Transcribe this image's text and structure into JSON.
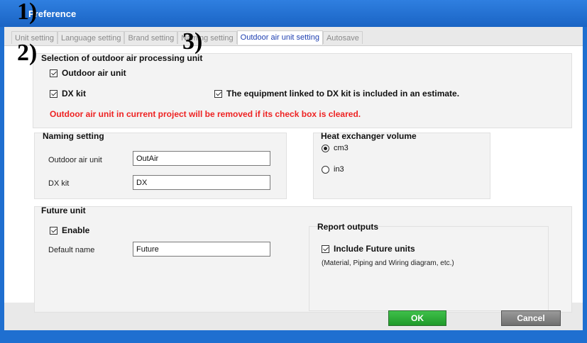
{
  "window": {
    "title": "Preference"
  },
  "tabs": [
    {
      "label": "Unit setting",
      "active": false
    },
    {
      "label": "Language setting",
      "active": false
    },
    {
      "label": "Brand setting",
      "active": false
    },
    {
      "label": "Naming setting",
      "active": false
    },
    {
      "label": "Outdoor air unit setting",
      "active": true
    },
    {
      "label": "Autosave",
      "active": false
    }
  ],
  "annotations": [
    "1)",
    "2)",
    "3)"
  ],
  "selection_group": {
    "title": "Selection of outdoor air processing unit",
    "outdoor_air_unit": {
      "label": "Outdoor air unit",
      "checked": true
    },
    "dx_kit": {
      "label": "DX kit",
      "checked": true
    },
    "linked_equipment": {
      "label": "The equipment linked to DX kit is included in an estimate.",
      "checked": true
    },
    "warning": "Outdoor air unit in current project will be removed if its check box is cleared."
  },
  "naming_group": {
    "title": "Naming setting",
    "outdoor_air_unit_label": "Outdoor air unit",
    "outdoor_air_unit_value": "OutAir",
    "dx_kit_label": "DX kit",
    "dx_kit_value": "DX"
  },
  "heat_exchanger_group": {
    "title": "Heat exchanger volume",
    "options": [
      {
        "label": "cm3",
        "selected": true
      },
      {
        "label": "in3",
        "selected": false
      }
    ]
  },
  "future_group": {
    "title": "Future unit",
    "enable": {
      "label": "Enable",
      "checked": true
    },
    "default_name_label": "Default name",
    "default_name_value": "Future"
  },
  "report_group": {
    "title": "Report outputs",
    "include_future": {
      "label": "Include Future units",
      "checked": true
    },
    "note": "(Material, Piping and Wiring diagram, etc.)"
  },
  "buttons": {
    "ok": "OK",
    "cancel": "Cancel"
  }
}
